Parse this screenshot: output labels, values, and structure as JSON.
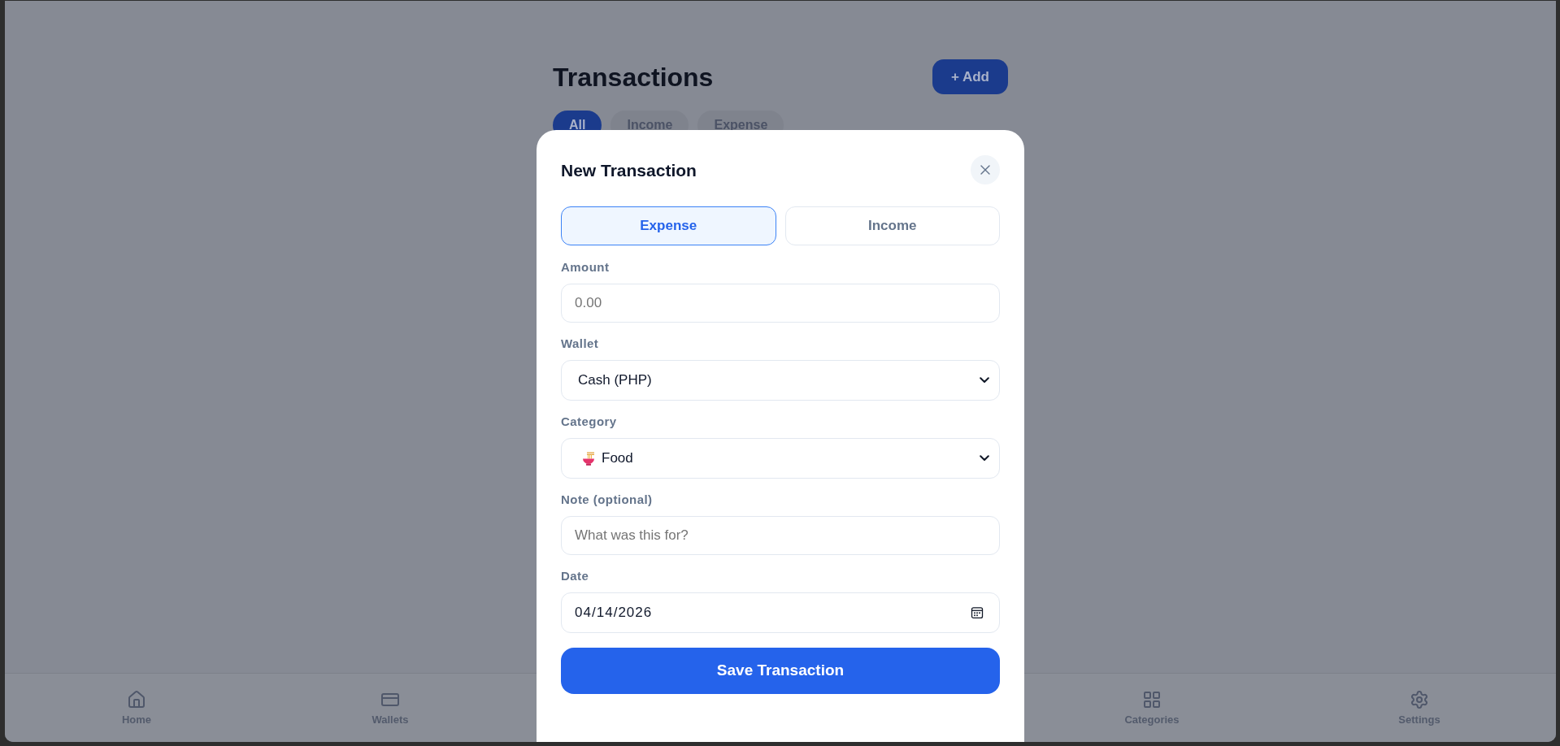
{
  "page": {
    "title": "Transactions",
    "add_button": "+ Add",
    "filter_tabs": [
      {
        "label": "All",
        "selected": true
      },
      {
        "label": "Income",
        "selected": false
      },
      {
        "label": "Expense",
        "selected": false
      }
    ]
  },
  "modal": {
    "title": "New Transaction",
    "type_toggle": [
      {
        "label": "Expense",
        "selected": true
      },
      {
        "label": "Income",
        "selected": false
      }
    ],
    "amount": {
      "label": "Amount",
      "placeholder": "0.00"
    },
    "wallet": {
      "label": "Wallet",
      "value": "Cash (PHP)"
    },
    "category": {
      "label": "Category",
      "value": "Food"
    },
    "note": {
      "label": "Note (optional)",
      "placeholder": "What was this for?"
    },
    "date": {
      "label": "Date",
      "value": "04/14/2026"
    },
    "save_button": "Save Transaction"
  },
  "bottom_nav": [
    {
      "label": "Home"
    },
    {
      "label": "Wallets"
    },
    {
      "label": "Categories"
    },
    {
      "label": "Settings"
    }
  ]
}
